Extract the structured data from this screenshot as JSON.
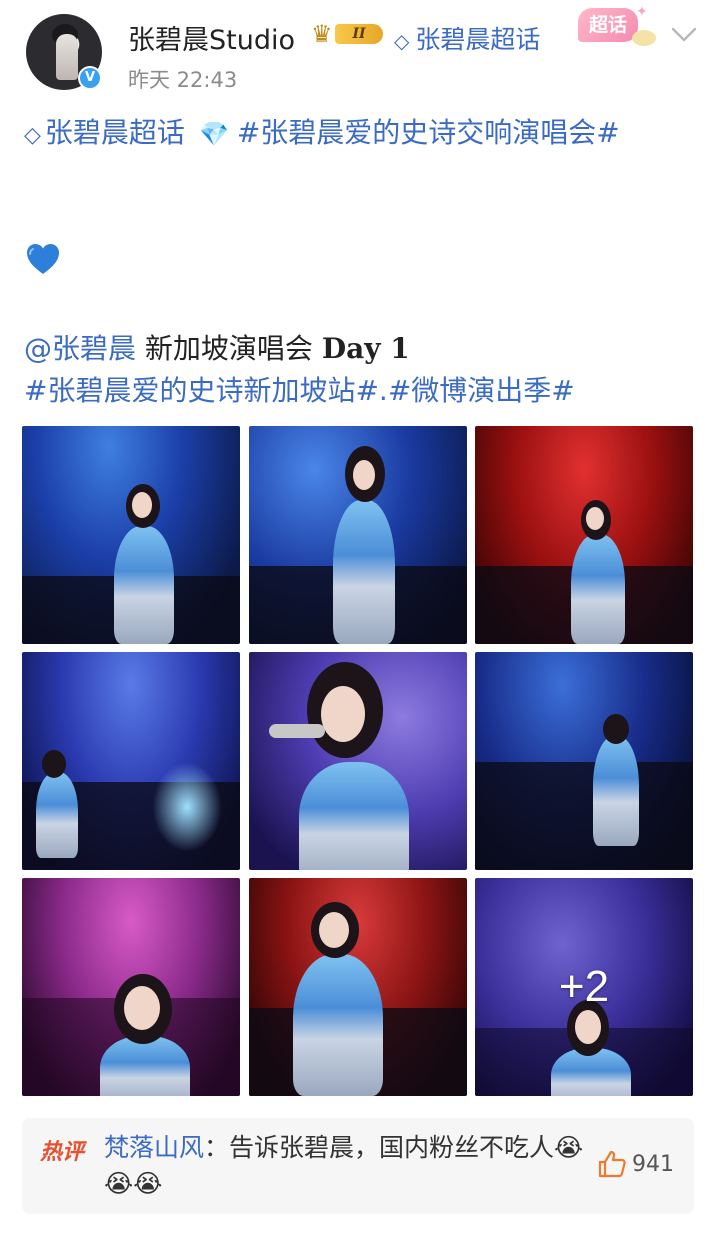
{
  "header": {
    "username": "张碧晨Studio",
    "level_badge": "II",
    "supertopic_link": "张碧晨超话",
    "supertopic_badge": "超话",
    "timestamp": "昨天 22:43"
  },
  "post": {
    "line1_tag1": "张碧晨超话",
    "line1_tag2": "#张碧晨爱的史诗交响演唱会#",
    "line3_mention": "@张碧晨",
    "line3_text": " 新加坡演唱会 ",
    "line3_day": "Day 1",
    "line4_tags": "#张碧晨爱的史诗新加坡站#.#微博演出季#"
  },
  "gallery": {
    "photos": [
      {
        "alt": "photo-1",
        "tone": "blue"
      },
      {
        "alt": "photo-2",
        "tone": "blue"
      },
      {
        "alt": "photo-3",
        "tone": "red"
      },
      {
        "alt": "photo-4",
        "tone": "blue"
      },
      {
        "alt": "photo-5",
        "tone": "purple"
      },
      {
        "alt": "photo-6",
        "tone": "blue-dark"
      },
      {
        "alt": "photo-7",
        "tone": "magenta"
      },
      {
        "alt": "photo-8",
        "tone": "red"
      },
      {
        "alt": "photo-9",
        "tone": "violet"
      }
    ],
    "more_count": "+2"
  },
  "hot_comment": {
    "label": "热评",
    "author": "梵落山风",
    "text": "：告诉张碧晨，国内粉丝不吃人😭😭😭",
    "like_count": "941"
  },
  "colors": {
    "link": "#3c6bc4",
    "hot": "#e8502f",
    "like_icon": "#f07a2c"
  },
  "icons": {
    "chevron": "chevron-down-icon",
    "verified": "verified-v-icon",
    "crown": "crown-icon",
    "diamond": "diamond-outline-icon",
    "gem": "gem-icon",
    "heart": "blue-heart-icon",
    "like": "thumbs-up-icon"
  }
}
